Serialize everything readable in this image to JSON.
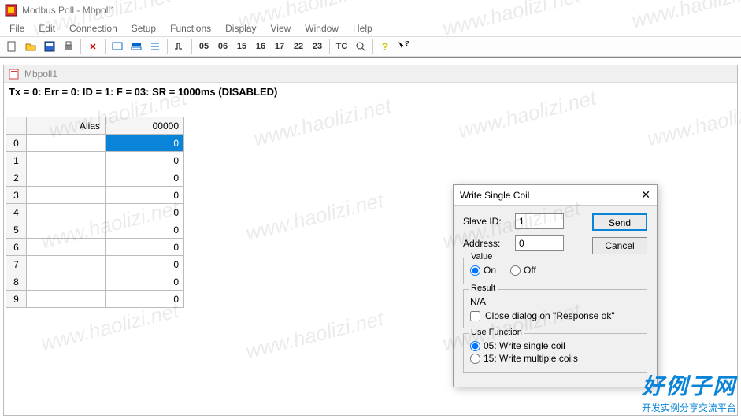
{
  "app": {
    "title": "Modbus Poll - Mbpoll1"
  },
  "menus": [
    "File",
    "Edit",
    "Connection",
    "Setup",
    "Functions",
    "Display",
    "View",
    "Window",
    "Help"
  ],
  "toolbar": {
    "codes": [
      "05",
      "06",
      "15",
      "16",
      "17",
      "22",
      "23"
    ],
    "tc": "TC"
  },
  "child": {
    "title": "Mbpoll1",
    "status": "Tx = 0: Err = 0: ID = 1: F = 03: SR = 1000ms  (DISABLED)"
  },
  "grid": {
    "headers": {
      "alias": "Alias",
      "value": "00000"
    },
    "rows": [
      {
        "idx": "0",
        "alias": "",
        "value": "0",
        "selected": true
      },
      {
        "idx": "1",
        "alias": "",
        "value": "0"
      },
      {
        "idx": "2",
        "alias": "",
        "value": "0"
      },
      {
        "idx": "3",
        "alias": "",
        "value": "0"
      },
      {
        "idx": "4",
        "alias": "",
        "value": "0"
      },
      {
        "idx": "5",
        "alias": "",
        "value": "0"
      },
      {
        "idx": "6",
        "alias": "",
        "value": "0"
      },
      {
        "idx": "7",
        "alias": "",
        "value": "0"
      },
      {
        "idx": "8",
        "alias": "",
        "value": "0"
      },
      {
        "idx": "9",
        "alias": "",
        "value": "0"
      }
    ]
  },
  "dialog": {
    "title": "Write Single Coil",
    "slave_id_label": "Slave ID:",
    "slave_id_value": "1",
    "address_label": "Address:",
    "address_value": "0",
    "send_label": "Send",
    "cancel_label": "Cancel",
    "value_legend": "Value",
    "value_on": "On",
    "value_off": "Off",
    "result_legend": "Result",
    "result_text": "N/A",
    "close_on_ok": "Close dialog on \"Response ok\"",
    "use_fn_legend": "Use Function",
    "fn05": "05: Write single coil",
    "fn15": "15: Write multiple coils"
  },
  "watermark": "www.haolizi.net",
  "brand": {
    "big": "好例子网",
    "sub": "开发实例分享交流平台"
  }
}
